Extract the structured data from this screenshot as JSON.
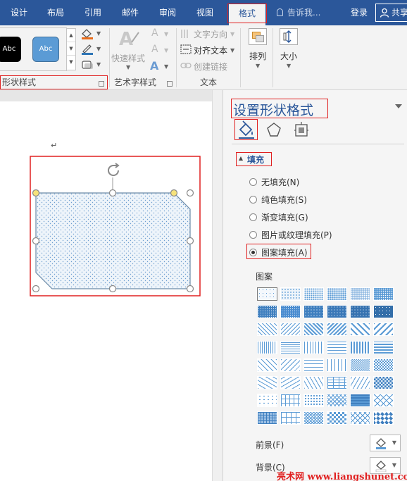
{
  "tabs": [
    "设计",
    "布局",
    "引用",
    "邮件",
    "审阅",
    "视图",
    "格式"
  ],
  "active_tab": "格式",
  "tell_me_placeholder": "告诉我...",
  "login_label": "登录",
  "share_label": "共享",
  "ribbon": {
    "shape_styles": {
      "abc_dark": "Abc",
      "abc_blue": "Abc",
      "group_label": "形状样式"
    },
    "wordart": {
      "quick_styles": "快速样式",
      "group_label": "艺术字样式"
    },
    "text": {
      "direction": "文字方向",
      "align": "对齐文本",
      "link": "创建链接",
      "group_label": "文本"
    },
    "arrange": "排列",
    "size": "大小"
  },
  "document": {
    "paragraph_mark": "↵"
  },
  "pane": {
    "title": "设置形状格式",
    "section": "填充",
    "fill_options": [
      {
        "label": "无填充(N)",
        "selected": false
      },
      {
        "label": "纯色填充(S)",
        "selected": false
      },
      {
        "label": "渐变填充(G)",
        "selected": false
      },
      {
        "label": "图片或纹理填充(P)",
        "selected": false
      },
      {
        "label": "图案填充(A)",
        "selected": true
      }
    ],
    "pattern_label": "图案",
    "foreground_label": "前景(F)",
    "background_label": "背景(C)"
  },
  "watermark": "亮术网 www.liangshunet.com",
  "colors": {
    "ribbon_blue": "#2b579a",
    "highlight_red": "#e02020",
    "pattern_blue": "#5b9bd5",
    "shape_fill": "#e4eef7"
  }
}
